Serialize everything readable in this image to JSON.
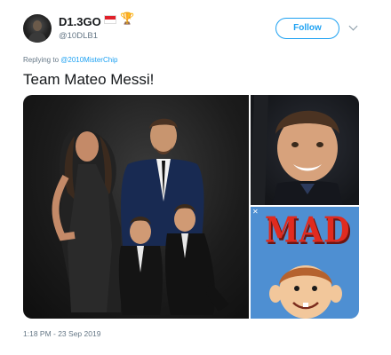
{
  "tweet": {
    "display_name": "D1.3GO",
    "trophy_glyph": "🏆",
    "handle": "@10DLB1",
    "follow_label": "Follow",
    "replying_prefix": "Replying to",
    "replying_to": "@2010MisterChip",
    "text": "Team Mateo Messi!",
    "timestamp": "1:18 PM - 23 Sep 2019"
  },
  "media": {
    "tile_text": "MAD",
    "close_glyph": "✕"
  },
  "colors": {
    "accent": "#1da1f2",
    "secondary_text": "#657786",
    "mad_red": "#e02b1f",
    "mad_background": "#4e8fd2"
  }
}
